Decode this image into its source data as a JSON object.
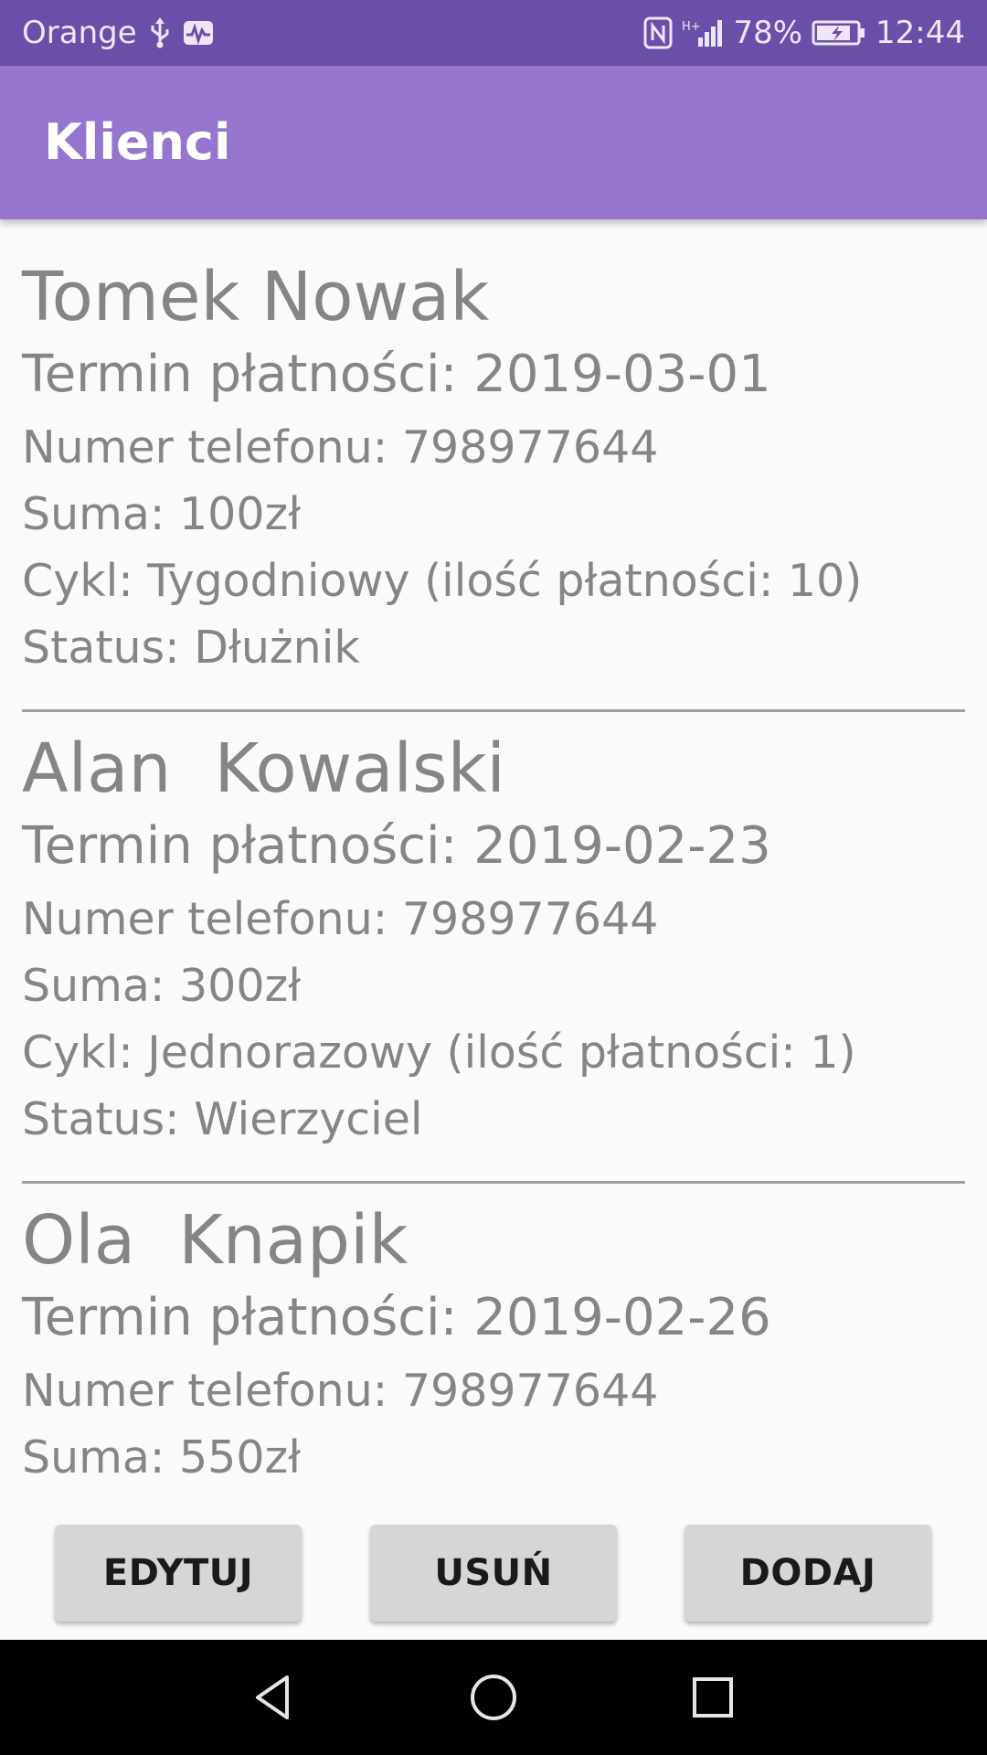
{
  "status_bar": {
    "carrier": "Orange",
    "network": "H+",
    "battery": "78%",
    "time": "12:44",
    "icons": [
      "usb-icon",
      "activity-icon",
      "nfc-icon",
      "signal-icon",
      "battery-charging-icon"
    ]
  },
  "app_bar": {
    "title": "Klienci",
    "color": "#9575cd"
  },
  "clients": [
    {
      "name": "Tomek Nowak",
      "due_date": "Termin płatności: 2019-03-01",
      "phone": "Numer telefonu: 798977644",
      "sum": "Suma: 100zł",
      "cycle": "Cykl: Tygodniowy (ilość płatności: 10)",
      "status": "Status: Dłużnik"
    },
    {
      "name": "Alan  Kowalski",
      "due_date": "Termin płatności: 2019-02-23",
      "phone": "Numer telefonu: 798977644",
      "sum": "Suma: 300zł",
      "cycle": "Cykl: Jednorazowy (ilość płatności: 1)",
      "status": "Status: Wierzyciel"
    },
    {
      "name": "Ola  Knapik",
      "due_date": "Termin płatności: 2019-02-26",
      "phone": "Numer telefonu: 798977644",
      "sum": "Suma: 550zł"
    }
  ],
  "buttons": {
    "edit": "EDYTUJ",
    "delete": "USUŃ",
    "add": "DODAJ"
  },
  "nav_bar": {
    "icons": [
      "back-icon",
      "home-icon",
      "recent-apps-icon"
    ]
  },
  "colors": {
    "status_bar": "#6a4fa8",
    "app_bar": "#9575cd",
    "text": "#858585",
    "button": "#d6d6d6"
  }
}
